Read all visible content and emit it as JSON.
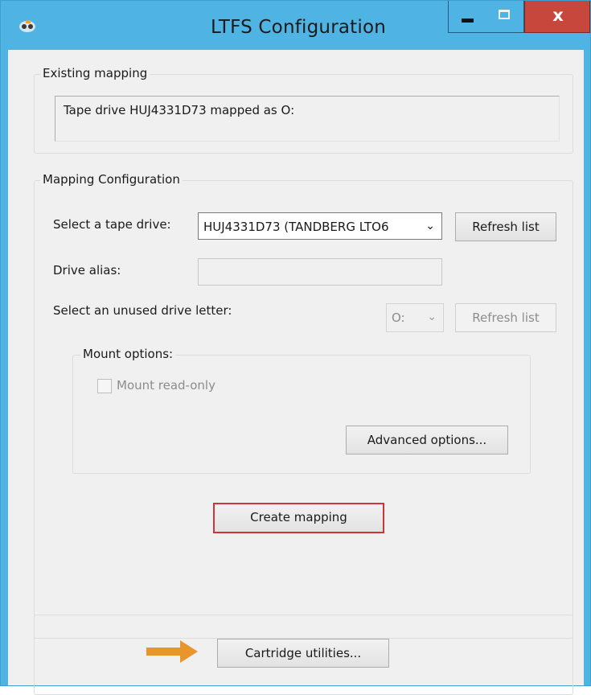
{
  "window": {
    "title": "LTFS Configuration",
    "controls": {
      "minimize": "minimize",
      "maximize": "maximize",
      "close": "x"
    }
  },
  "existing_mapping": {
    "legend": "Existing mapping",
    "text": "Tape drive HUJ4331D73 mapped as  O:"
  },
  "mapping_configuration": {
    "legend": "Mapping Configuration",
    "tape_drive_label": "Select a tape drive:",
    "tape_drive_value": "HUJ4331D73 (TANDBERG LTO6",
    "refresh_list_1": "Refresh list",
    "drive_alias_label": "Drive alias:",
    "drive_alias_value": "",
    "drive_letter_label": "Select an unused drive letter:",
    "drive_letter_value": "O:",
    "refresh_list_2": "Refresh list",
    "mount_options": {
      "legend": "Mount options:",
      "read_only_label": "Mount read-only",
      "read_only_checked": false,
      "advanced_button": "Advanced options..."
    },
    "create_button": "Create mapping"
  },
  "utilities": {
    "cartridge_button": "Cartridge utilities..."
  },
  "colors": {
    "titlebar": "#4fb3e3",
    "close_button": "#c8473c",
    "focus_outline": "#d0343b",
    "annotation_arrow": "#e8952c"
  },
  "icons": {
    "app": "tape-app-icon",
    "annotation": "arrow-right-icon"
  }
}
